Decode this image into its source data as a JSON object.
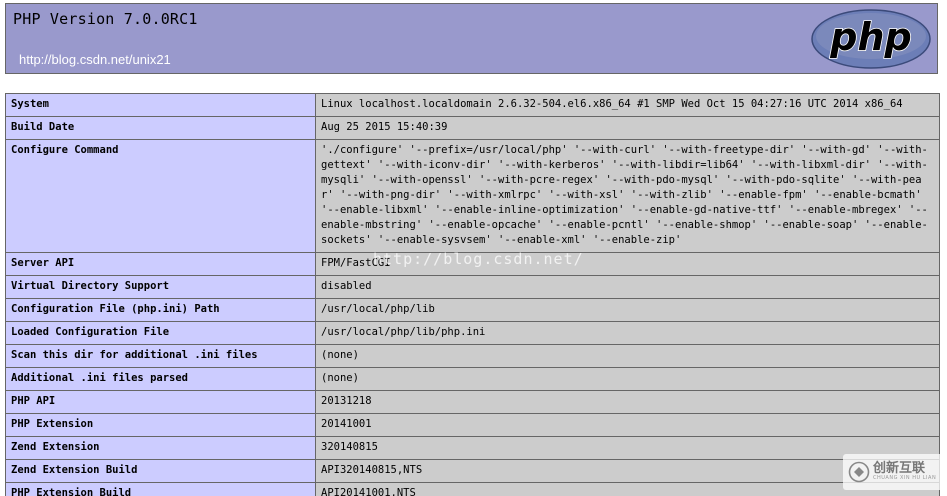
{
  "header": {
    "title": "PHP Version 7.0.0RC1",
    "url": "http://blog.csdn.net/unix21",
    "logo": "php-logo",
    "logo_text": "php"
  },
  "rows": [
    {
      "key": "System",
      "value": "Linux localhost.localdomain 2.6.32-504.el6.x86_64 #1 SMP Wed Oct 15 04:27:16 UTC 2014 x86_64"
    },
    {
      "key": "Build Date",
      "value": "Aug 25 2015 15:40:39"
    },
    {
      "key": "Configure Command",
      "value": "'./configure' '--prefix=/usr/local/php' '--with-curl' '--with-freetype-dir' '--with-gd' '--with-gettext' '--with-iconv-dir' '--with-kerberos' '--with-libdir=lib64' '--with-libxml-dir' '--with-mysqli' '--with-openssl' '--with-pcre-regex' '--with-pdo-mysql' '--with-pdo-sqlite' '--with-pear' '--with-png-dir' '--with-xmlrpc' '--with-xsl' '--with-zlib' '--enable-fpm' '--enable-bcmath' '--enable-libxml' '--enable-inline-optimization' '--enable-gd-native-ttf' '--enable-mbregex' '--enable-mbstring' '--enable-opcache' '--enable-pcntl' '--enable-shmop' '--enable-soap' '--enable-sockets' '--enable-sysvsem' '--enable-xml' '--enable-zip'"
    },
    {
      "key": "Server API",
      "value": "FPM/FastCGI"
    },
    {
      "key": "Virtual Directory Support",
      "value": "disabled"
    },
    {
      "key": "Configuration File (php.ini) Path",
      "value": "/usr/local/php/lib"
    },
    {
      "key": "Loaded Configuration File",
      "value": "/usr/local/php/lib/php.ini"
    },
    {
      "key": "Scan this dir for additional .ini files",
      "value": "(none)"
    },
    {
      "key": "Additional .ini files parsed",
      "value": "(none)"
    },
    {
      "key": "PHP API",
      "value": "20131218"
    },
    {
      "key": "PHP Extension",
      "value": "20141001"
    },
    {
      "key": "Zend Extension",
      "value": "320140815"
    },
    {
      "key": "Zend Extension Build",
      "value": "API320140815,NTS"
    },
    {
      "key": "PHP Extension Build",
      "value": "API20141001,NTS"
    }
  ],
  "watermark": {
    "center": "http://blog.csdn.net/",
    "corner": "创新互联",
    "corner_sub": "CHUANG XIN HU LIAN",
    "corner_icon": "chuangxin-logo-icon"
  },
  "colors": {
    "header_bg": "#9999cc",
    "key_bg": "#ccccff",
    "value_bg": "#cccccc",
    "border": "#666666"
  }
}
